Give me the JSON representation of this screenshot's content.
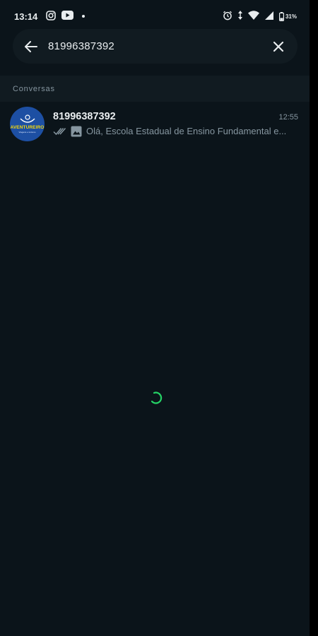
{
  "status_bar": {
    "time": "13:14",
    "battery": "31%",
    "icons": [
      "instagram-icon",
      "youtube-icon",
      "notification-dot",
      "alarm-icon",
      "data-arrows-icon",
      "wifi-icon",
      "signal-icon",
      "battery-icon"
    ]
  },
  "search": {
    "value": "81996387392",
    "back_icon": "arrow-left-icon",
    "clear_icon": "close-icon"
  },
  "section": {
    "title": "Conversas"
  },
  "chats": [
    {
      "name": "81996387392",
      "time": "12:55",
      "preview": "Olá, Escola Estadual de Ensino Fundamental e...",
      "avatar_text": "AVENTUREIRO",
      "avatar_sub": "Viagens e turismo",
      "status_icon": "double-check-icon",
      "media_icon": "image-icon"
    }
  ],
  "colors": {
    "background": "#0b141a",
    "panel": "#111b21",
    "text_primary": "#e9edef",
    "text_secondary": "#8696a0",
    "accent": "#25d366"
  }
}
